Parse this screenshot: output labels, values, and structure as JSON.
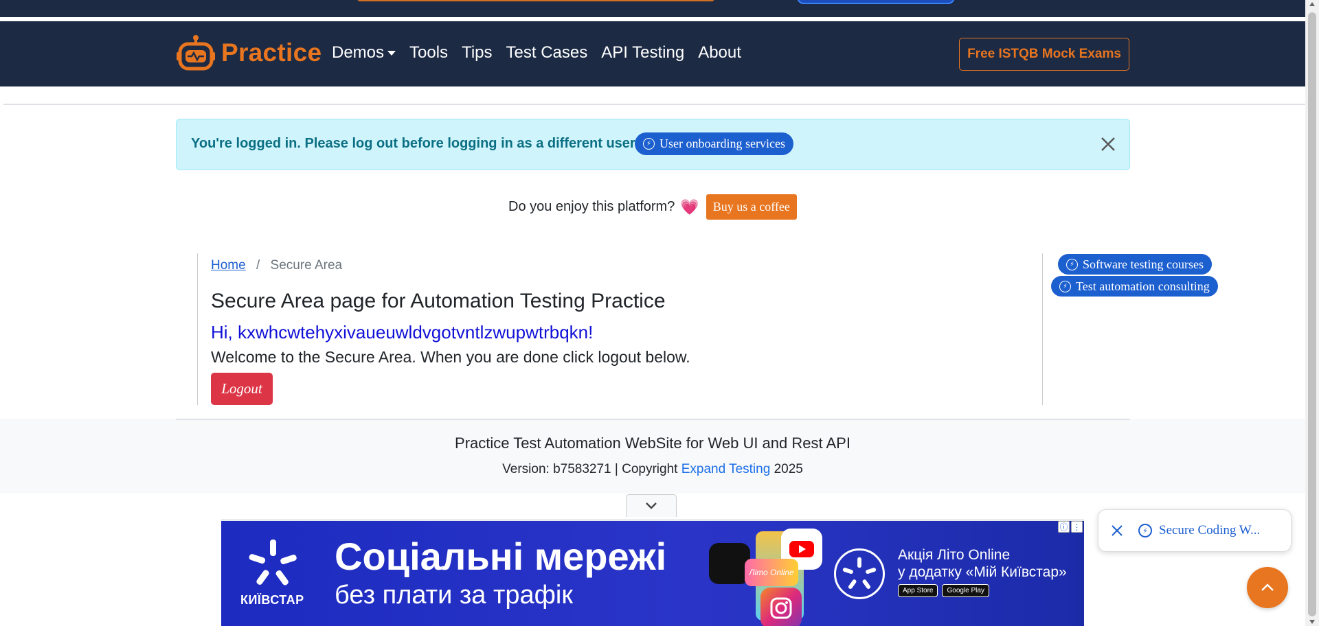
{
  "brand": {
    "name": "Practice",
    "logo_icon": "robot-icon",
    "color": "#e8751f"
  },
  "nav": {
    "items": [
      {
        "label": "Demos",
        "has_dropdown": true
      },
      {
        "label": "Tools"
      },
      {
        "label": "Tips"
      },
      {
        "label": "Test Cases"
      },
      {
        "label": "API Testing"
      },
      {
        "label": "About"
      }
    ],
    "cta_label": "Free ISTQB Mock Exams"
  },
  "alert": {
    "message": "You're logged in. Please log out before logging in as a different user",
    "pill_label": "User onboarding services",
    "pill_icon": "bolt-icon",
    "close_icon": "close-icon"
  },
  "enjoy": {
    "question": "Do you enjoy this platform?",
    "heart": "💗",
    "button_label": "Buy us a coffee"
  },
  "breadcrumb": {
    "home": "Home",
    "separator": "/",
    "current": "Secure Area"
  },
  "main": {
    "title": "Secure Area page for Automation Testing Practice",
    "greeting": "Hi, kxwhcwtehyxivaueuwldvgotvntlzwupwtrbqkn!",
    "welcome": "Welcome to the Secure Area. When you are done click logout below.",
    "logout_label": "Logout"
  },
  "sidebar": {
    "pills": [
      {
        "label": "Software testing courses",
        "icon": "bolt-icon"
      },
      {
        "label": "Test automation consulting",
        "icon": "bolt-icon"
      }
    ]
  },
  "footer": {
    "title": "Practice Test Automation WebSite for Web UI and Rest API",
    "version_prefix": "Version: b7583271 | Copyright",
    "company_link": "Expand Testing",
    "year": "2025"
  },
  "ad": {
    "brand": "КИЇВСТАР",
    "headline": "Соціальні мережі",
    "subline": "без плати за трафік",
    "tile_label": "Літо Online",
    "promo_line1": "Акція Літо Online",
    "promo_line2": "у додатку «Мій Київстар»",
    "badge_appstore": "App Store",
    "badge_googleplay": "Google Play",
    "info_icon": "info-icon",
    "more_icon": "more-icon"
  },
  "toast": {
    "label": "Secure Coding W...",
    "icon": "bolt-icon"
  },
  "colors": {
    "navbar_bg": "#1c2a44",
    "accent": "#e8751f",
    "alert_bg": "#cff4fc",
    "alert_text": "#0a6f82",
    "pill_blue": "#1c5fcf",
    "danger": "#dc3545",
    "greeting_blue": "#1010d8",
    "ad_bg": "#1d2bc0"
  }
}
